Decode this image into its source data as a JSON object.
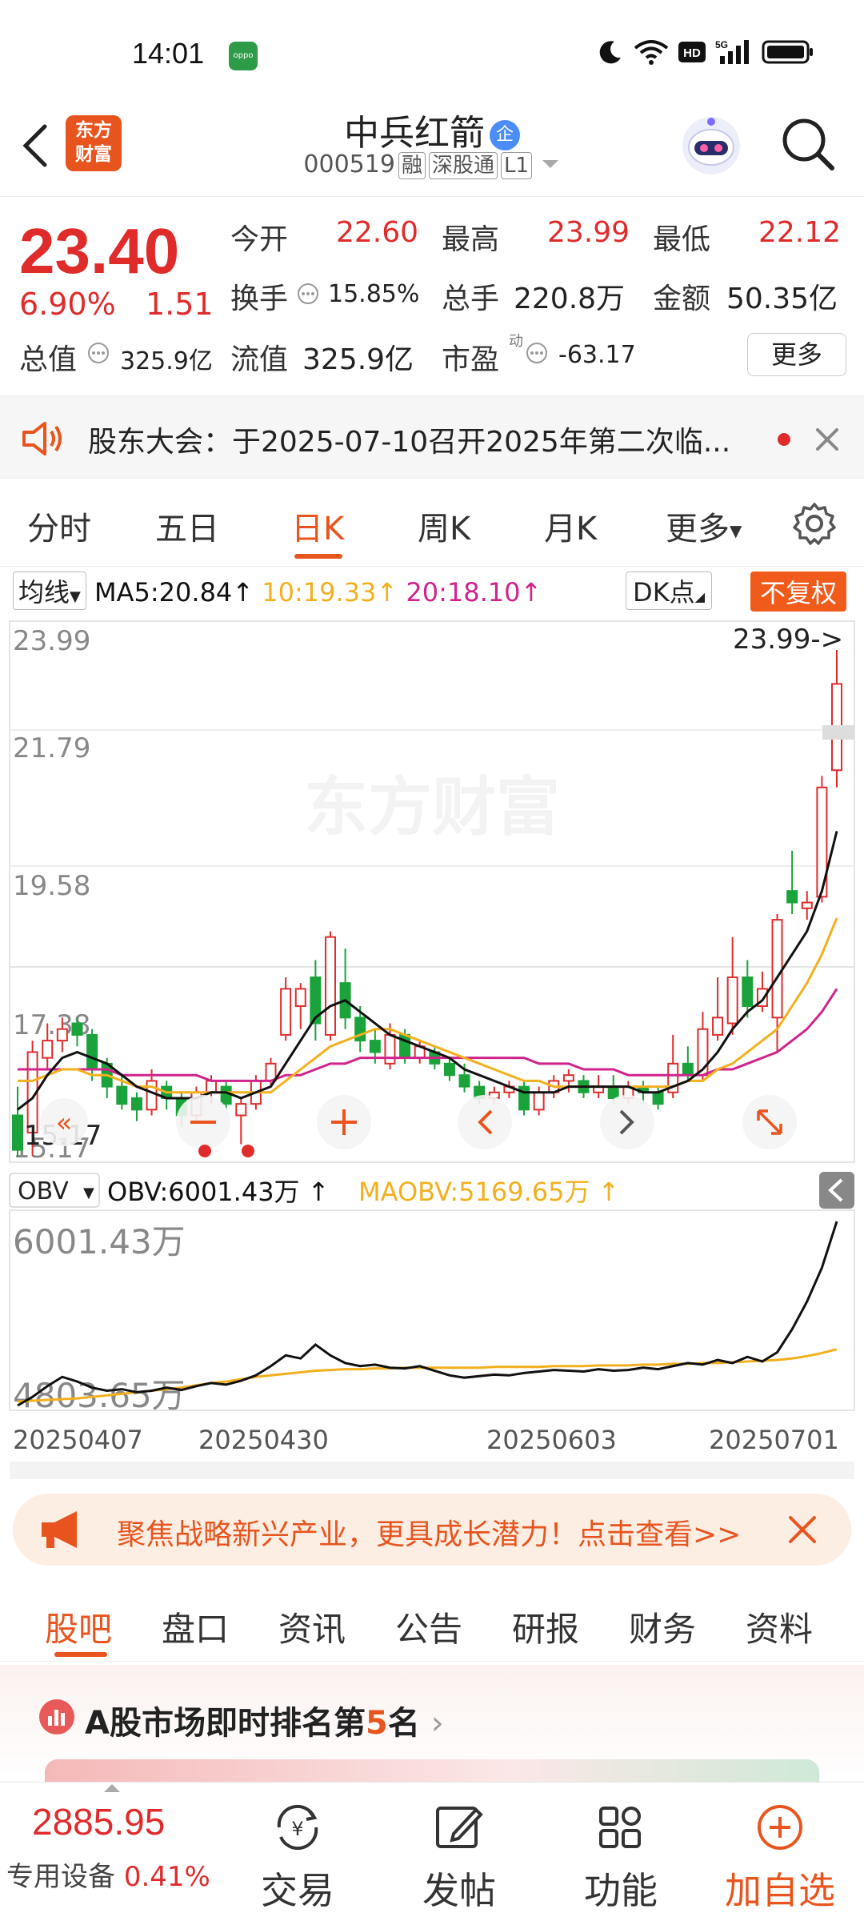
{
  "status_bar": {
    "time": "14:01",
    "network": "5G"
  },
  "header": {
    "logo_line1": "东方",
    "logo_line2": "财富",
    "stock_name": "中兵红箭",
    "badge": "企",
    "stock_code": "000519",
    "tags": [
      "融",
      "深股通",
      "L1"
    ]
  },
  "quote": {
    "price": "23.40",
    "change_pct": "6.90%",
    "change": "1.51",
    "open_label": "今开",
    "open": "22.60",
    "high_label": "最高",
    "high": "23.99",
    "low_label": "最低",
    "low": "22.12",
    "turnover_label": "换手",
    "turnover": "15.85%",
    "volume_label": "总手",
    "volume": "220.8万",
    "amount_label": "金额",
    "amount": "50.35亿",
    "mktcap_label": "总值",
    "mktcap": "325.9亿",
    "float_label": "流值",
    "float": "325.9亿",
    "pe_label": "市盈",
    "pe_sup": "动",
    "pe": "-63.17",
    "more_button": "更多"
  },
  "notice": {
    "text": "股东大会：于2025-07-10召开2025年第二次临..."
  },
  "chart_tabs": [
    {
      "label": "分时"
    },
    {
      "label": "五日"
    },
    {
      "label": "日K"
    },
    {
      "label": "周K"
    },
    {
      "label": "月K"
    },
    {
      "label": "更多"
    }
  ],
  "main_indicator": {
    "select": "均线",
    "ma5": "MA5:20.84",
    "ma10": "10:19.33",
    "ma20": "20:18.10",
    "dk_button": "DK点",
    "fq_button": "不复权",
    "colors": {
      "ma5": "#111111",
      "ma10": "#f2b01e",
      "ma20": "#d0238c",
      "up": "#e02b2b",
      "down": "#1aa33a"
    }
  },
  "price_axis": [
    "23.99",
    "21.79",
    "19.58",
    "17.38",
    "15.17"
  ],
  "max_label": "23.99->",
  "min_label": "15.17",
  "watermark": "东方财富",
  "sub_indicator": {
    "select": "OBV",
    "obv": "OBV:6001.43万",
    "maobv": "MAOBV:5169.65万",
    "axis_top": "6001.43万",
    "axis_bottom": "4803.65万"
  },
  "date_axis": [
    "20250407",
    "20250430",
    "20250603",
    "20250701"
  ],
  "chart_data": {
    "type": "candlestick",
    "title": "",
    "ylim": [
      15.17,
      23.99
    ],
    "candles": [
      {
        "o": 15.9,
        "c": 15.3,
        "h": 16.4,
        "l": 15.17
      },
      {
        "o": 15.6,
        "c": 17.0,
        "h": 17.2,
        "l": 15.2
      },
      {
        "o": 16.9,
        "c": 17.2,
        "h": 17.5,
        "l": 16.7
      },
      {
        "o": 17.2,
        "c": 17.4,
        "h": 17.6,
        "l": 17.0
      },
      {
        "o": 17.5,
        "c": 17.3,
        "h": 17.6,
        "l": 17.1
      },
      {
        "o": 17.3,
        "c": 16.7,
        "h": 17.4,
        "l": 16.5
      },
      {
        "o": 16.8,
        "c": 16.4,
        "h": 16.9,
        "l": 16.2
      },
      {
        "o": 16.4,
        "c": 16.1,
        "h": 16.6,
        "l": 16.0
      },
      {
        "o": 16.2,
        "c": 16.0,
        "h": 16.3,
        "l": 15.8
      },
      {
        "o": 16.0,
        "c": 16.5,
        "h": 16.7,
        "l": 15.9
      },
      {
        "o": 16.4,
        "c": 16.2,
        "h": 16.5,
        "l": 16.0
      },
      {
        "o": 16.2,
        "c": 15.9,
        "h": 16.3,
        "l": 15.7
      },
      {
        "o": 15.9,
        "c": 16.3,
        "h": 16.4,
        "l": 15.8
      },
      {
        "o": 16.3,
        "c": 16.5,
        "h": 16.6,
        "l": 16.1
      },
      {
        "o": 16.4,
        "c": 16.1,
        "h": 16.5,
        "l": 16.0
      },
      {
        "o": 15.9,
        "c": 16.1,
        "h": 16.2,
        "l": 15.4
      },
      {
        "o": 16.1,
        "c": 16.5,
        "h": 16.6,
        "l": 16.0
      },
      {
        "o": 16.5,
        "c": 16.8,
        "h": 16.9,
        "l": 16.4
      },
      {
        "o": 17.3,
        "c": 18.1,
        "h": 18.3,
        "l": 17.2
      },
      {
        "o": 17.8,
        "c": 18.1,
        "h": 18.2,
        "l": 17.4
      },
      {
        "o": 18.3,
        "c": 17.5,
        "h": 18.6,
        "l": 17.2
      },
      {
        "o": 17.3,
        "c": 19.0,
        "h": 19.1,
        "l": 17.2
      },
      {
        "o": 18.2,
        "c": 17.6,
        "h": 18.8,
        "l": 17.4
      },
      {
        "o": 17.6,
        "c": 17.2,
        "h": 17.8,
        "l": 17.0
      },
      {
        "o": 17.2,
        "c": 17.0,
        "h": 17.4,
        "l": 16.8
      },
      {
        "o": 16.8,
        "c": 17.3,
        "h": 17.5,
        "l": 16.7
      },
      {
        "o": 17.3,
        "c": 16.9,
        "h": 17.4,
        "l": 16.8
      },
      {
        "o": 16.9,
        "c": 17.1,
        "h": 17.2,
        "l": 16.8
      },
      {
        "o": 17.0,
        "c": 16.8,
        "h": 17.1,
        "l": 16.7
      },
      {
        "o": 16.8,
        "c": 16.6,
        "h": 16.9,
        "l": 16.5
      },
      {
        "o": 16.6,
        "c": 16.4,
        "h": 16.8,
        "l": 16.3
      },
      {
        "o": 16.4,
        "c": 16.2,
        "h": 16.5,
        "l": 16.1
      },
      {
        "o": 16.2,
        "c": 16.3,
        "h": 16.4,
        "l": 16.1
      },
      {
        "o": 16.3,
        "c": 16.4,
        "h": 16.5,
        "l": 16.2
      },
      {
        "o": 16.4,
        "c": 16.0,
        "h": 16.5,
        "l": 15.9
      },
      {
        "o": 16.0,
        "c": 16.3,
        "h": 16.4,
        "l": 15.9
      },
      {
        "o": 16.3,
        "c": 16.5,
        "h": 16.6,
        "l": 16.2
      },
      {
        "o": 16.5,
        "c": 16.6,
        "h": 16.7,
        "l": 16.3
      },
      {
        "o": 16.5,
        "c": 16.3,
        "h": 16.6,
        "l": 16.2
      },
      {
        "o": 16.3,
        "c": 16.4,
        "h": 16.6,
        "l": 16.2
      },
      {
        "o": 16.4,
        "c": 16.2,
        "h": 16.6,
        "l": 16.1
      },
      {
        "o": 16.2,
        "c": 16.4,
        "h": 16.5,
        "l": 16.1
      },
      {
        "o": 16.4,
        "c": 16.3,
        "h": 16.5,
        "l": 16.1
      },
      {
        "o": 16.3,
        "c": 16.1,
        "h": 16.4,
        "l": 16.0
      },
      {
        "o": 16.3,
        "c": 16.8,
        "h": 17.3,
        "l": 16.2
      },
      {
        "o": 16.8,
        "c": 16.6,
        "h": 17.1,
        "l": 16.5
      },
      {
        "o": 16.6,
        "c": 17.4,
        "h": 17.7,
        "l": 16.5
      },
      {
        "o": 17.3,
        "c": 17.6,
        "h": 18.3,
        "l": 17.2
      },
      {
        "o": 17.5,
        "c": 18.3,
        "h": 19.0,
        "l": 17.3
      },
      {
        "o": 18.3,
        "c": 17.8,
        "h": 18.6,
        "l": 17.6
      },
      {
        "o": 17.8,
        "c": 18.1,
        "h": 18.4,
        "l": 17.7
      },
      {
        "o": 17.6,
        "c": 19.3,
        "h": 19.4,
        "l": 17.0
      },
      {
        "o": 19.8,
        "c": 19.6,
        "h": 20.5,
        "l": 19.4
      },
      {
        "o": 19.5,
        "c": 19.6,
        "h": 19.8,
        "l": 19.3
      },
      {
        "o": 19.7,
        "c": 21.6,
        "h": 21.8,
        "l": 19.6
      },
      {
        "o": 21.9,
        "c": 23.4,
        "h": 23.99,
        "l": 21.6
      }
    ],
    "ma5": [
      16.0,
      16.2,
      16.6,
      16.9,
      17.0,
      16.9,
      16.8,
      16.6,
      16.4,
      16.3,
      16.2,
      16.2,
      16.2,
      16.3,
      16.3,
      16.2,
      16.3,
      16.4,
      16.8,
      17.2,
      17.6,
      17.8,
      17.9,
      17.7,
      17.5,
      17.3,
      17.2,
      17.1,
      17.0,
      16.9,
      16.7,
      16.6,
      16.5,
      16.4,
      16.3,
      16.3,
      16.3,
      16.4,
      16.4,
      16.4,
      16.4,
      16.4,
      16.3,
      16.3,
      16.4,
      16.5,
      16.7,
      17.0,
      17.4,
      17.7,
      17.9,
      18.3,
      18.7,
      19.1,
      19.8,
      20.84
    ],
    "ma10": [
      16.5,
      16.5,
      16.6,
      16.7,
      16.7,
      16.6,
      16.6,
      16.5,
      16.4,
      16.4,
      16.3,
      16.3,
      16.3,
      16.3,
      16.3,
      16.3,
      16.3,
      16.3,
      16.5,
      16.7,
      16.9,
      17.1,
      17.2,
      17.3,
      17.4,
      17.4,
      17.3,
      17.2,
      17.1,
      17.0,
      16.9,
      16.8,
      16.7,
      16.6,
      16.5,
      16.5,
      16.4,
      16.4,
      16.4,
      16.4,
      16.4,
      16.4,
      16.4,
      16.4,
      16.4,
      16.5,
      16.5,
      16.7,
      16.8,
      17.0,
      17.2,
      17.4,
      17.8,
      18.2,
      18.7,
      19.33
    ],
    "ma20": [
      16.7,
      16.7,
      16.7,
      16.7,
      16.7,
      16.7,
      16.7,
      16.6,
      16.6,
      16.6,
      16.6,
      16.6,
      16.6,
      16.5,
      16.5,
      16.5,
      16.5,
      16.5,
      16.6,
      16.6,
      16.7,
      16.8,
      16.8,
      16.9,
      16.9,
      16.9,
      16.9,
      16.9,
      16.9,
      16.9,
      16.9,
      16.9,
      16.9,
      16.9,
      16.9,
      16.8,
      16.8,
      16.8,
      16.7,
      16.7,
      16.7,
      16.6,
      16.6,
      16.6,
      16.6,
      16.6,
      16.6,
      16.7,
      16.7,
      16.8,
      16.9,
      17.0,
      17.2,
      17.4,
      17.7,
      18.1
    ],
    "obv": [
      4803.65,
      4860,
      4930,
      4990,
      4960,
      4920,
      4900,
      4910,
      4890,
      4900,
      4920,
      4905,
      4930,
      4950,
      4940,
      4965,
      5000,
      5060,
      5130,
      5110,
      5200,
      5130,
      5080,
      5060,
      5070,
      5050,
      5045,
      5060,
      5030,
      5000,
      4985,
      4995,
      5005,
      5000,
      5015,
      5025,
      5035,
      5030,
      5025,
      5040,
      5030,
      5035,
      5050,
      5040,
      5060,
      5080,
      5070,
      5100,
      5080,
      5120,
      5090,
      5150,
      5300,
      5480,
      5700,
      6001.43
    ],
    "maobv": [
      4830,
      4835,
      4840,
      4845,
      4850,
      4860,
      4870,
      4880,
      4890,
      4900,
      4910,
      4920,
      4935,
      4950,
      4960,
      4975,
      4990,
      5000,
      5010,
      5020,
      5030,
      5035,
      5040,
      5040,
      5045,
      5045,
      5050,
      5050,
      5050,
      5050,
      5050,
      5050,
      5055,
      5055,
      5055,
      5055,
      5060,
      5060,
      5060,
      5065,
      5065,
      5065,
      5070,
      5070,
      5075,
      5075,
      5080,
      5080,
      5085,
      5090,
      5095,
      5100,
      5110,
      5125,
      5145,
      5169.65
    ]
  },
  "promo_banner": {
    "text": "聚焦战略新兴产业，更具成长潜力！点击查看>>"
  },
  "bottom_tabs": [
    {
      "label": "股吧"
    },
    {
      "label": "盘口"
    },
    {
      "label": "资讯"
    },
    {
      "label": "公告"
    },
    {
      "label": "研报"
    },
    {
      "label": "财务"
    },
    {
      "label": "资料"
    }
  ],
  "rank": {
    "prefix": "A股市场即时排名第",
    "rank": "5",
    "suffix": "名"
  },
  "index_ticker": {
    "value": "2885.95",
    "name": "专用设备",
    "pct": "0.41%"
  },
  "bottom_bar": [
    {
      "label": "交易"
    },
    {
      "label": "发帖"
    },
    {
      "label": "功能"
    },
    {
      "label": "加自选"
    }
  ]
}
